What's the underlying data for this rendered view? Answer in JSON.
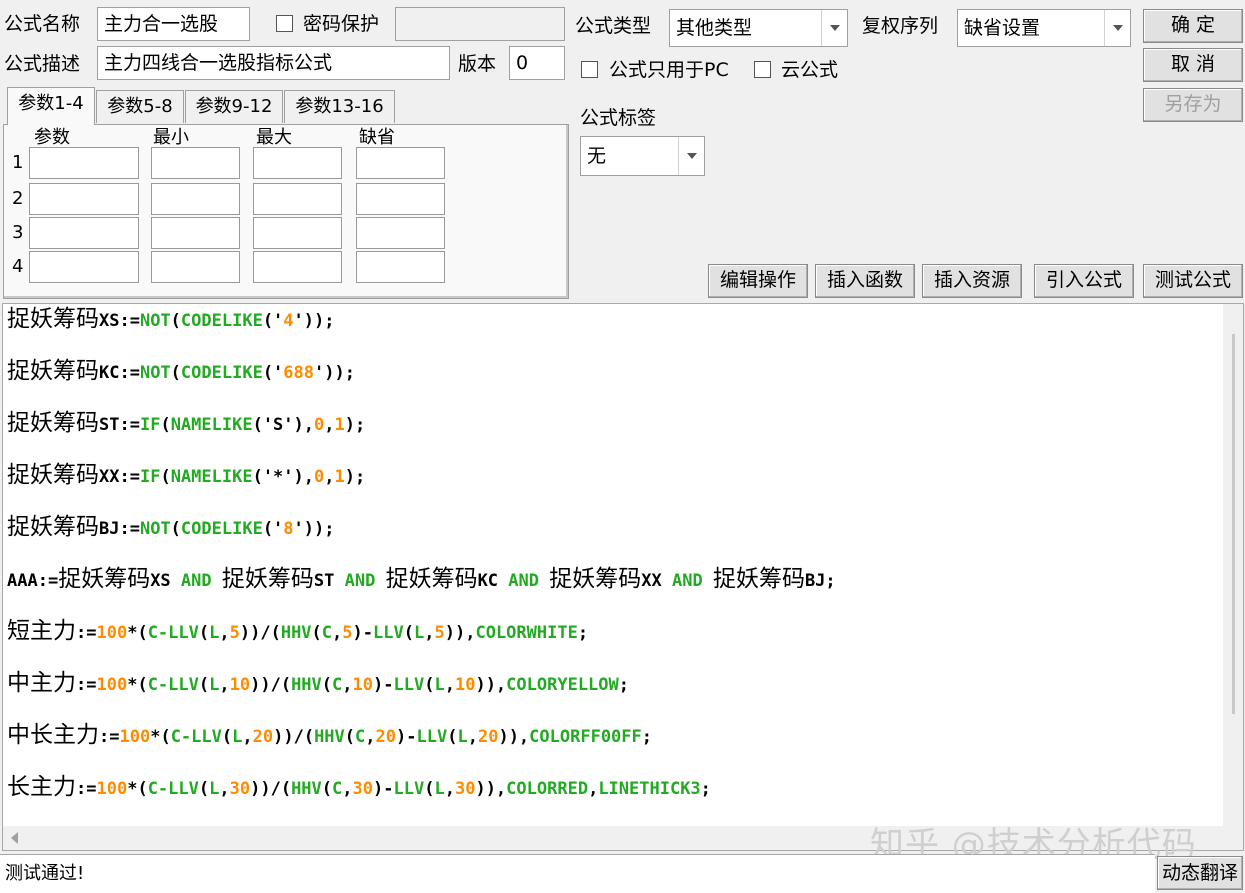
{
  "formula": {
    "name_label": "公式名称",
    "name_value": "主力合一选股",
    "password_label": "密码保护",
    "desc_label": "公式描述",
    "desc_value": "主力四线合一选股指标公式",
    "version_label": "版本",
    "version_value": "0",
    "type_label": "公式类型",
    "type_value": "其他类型",
    "copyright_label": "复权序列",
    "copyright_value": "缺省设置",
    "pc_only_label": "公式只用于PC",
    "cloud_label": "云公式",
    "tag_label": "公式标签",
    "tag_value": "无"
  },
  "buttons": {
    "ok": "确 定",
    "cancel": "取 消",
    "save_as": "另存为",
    "edit_ops": "编辑操作",
    "insert_func": "插入函数",
    "insert_res": "插入资源",
    "import_formula": "引入公式",
    "test_formula": "测试公式",
    "dynamic_translate": "动态翻译"
  },
  "tabs": [
    "参数1-4",
    "参数5-8",
    "参数9-12",
    "参数13-16"
  ],
  "param_headers": [
    "参数",
    "最小",
    "最大",
    "缺省"
  ],
  "param_rows": [
    "1",
    "2",
    "3",
    "4"
  ],
  "code_lines": [
    [
      {
        "t": "捉妖筹码",
        "c": "cn"
      },
      {
        "t": "XS:=",
        "c": "d"
      },
      {
        "t": "NOT",
        "c": "k"
      },
      {
        "t": "(",
        "c": "d"
      },
      {
        "t": "CODELIKE",
        "c": "k"
      },
      {
        "t": "('",
        "c": "d"
      },
      {
        "t": "4",
        "c": "n"
      },
      {
        "t": "'));",
        "c": "d"
      }
    ],
    [
      {
        "t": "捉妖筹码",
        "c": "cn"
      },
      {
        "t": "KC:=",
        "c": "d"
      },
      {
        "t": "NOT",
        "c": "k"
      },
      {
        "t": "(",
        "c": "d"
      },
      {
        "t": "CODELIKE",
        "c": "k"
      },
      {
        "t": "('",
        "c": "d"
      },
      {
        "t": "688",
        "c": "n"
      },
      {
        "t": "'));",
        "c": "d"
      }
    ],
    [
      {
        "t": "捉妖筹码",
        "c": "cn"
      },
      {
        "t": "ST:=",
        "c": "d"
      },
      {
        "t": "IF",
        "c": "k"
      },
      {
        "t": "(",
        "c": "d"
      },
      {
        "t": "NAMELIKE",
        "c": "k"
      },
      {
        "t": "('S'),",
        "c": "d"
      },
      {
        "t": "0",
        "c": "n"
      },
      {
        "t": ",",
        "c": "d"
      },
      {
        "t": "1",
        "c": "n"
      },
      {
        "t": ");",
        "c": "d"
      }
    ],
    [
      {
        "t": "捉妖筹码",
        "c": "cn"
      },
      {
        "t": "XX:=",
        "c": "d"
      },
      {
        "t": "IF",
        "c": "k"
      },
      {
        "t": "(",
        "c": "d"
      },
      {
        "t": "NAMELIKE",
        "c": "k"
      },
      {
        "t": "('*'),",
        "c": "d"
      },
      {
        "t": "0",
        "c": "n"
      },
      {
        "t": ",",
        "c": "d"
      },
      {
        "t": "1",
        "c": "n"
      },
      {
        "t": ");",
        "c": "d"
      }
    ],
    [
      {
        "t": "捉妖筹码",
        "c": "cn"
      },
      {
        "t": "BJ:=",
        "c": "d"
      },
      {
        "t": "NOT",
        "c": "k"
      },
      {
        "t": "(",
        "c": "d"
      },
      {
        "t": "CODELIKE",
        "c": "k"
      },
      {
        "t": "('",
        "c": "d"
      },
      {
        "t": "8",
        "c": "n"
      },
      {
        "t": "'));",
        "c": "d"
      }
    ],
    [
      {
        "t": "AAA:=",
        "c": "d"
      },
      {
        "t": "捉妖筹码",
        "c": "cn"
      },
      {
        "t": "XS ",
        "c": "d"
      },
      {
        "t": "AND",
        "c": "k"
      },
      {
        "t": " ",
        "c": "d"
      },
      {
        "t": "捉妖筹码",
        "c": "cn"
      },
      {
        "t": "ST ",
        "c": "d"
      },
      {
        "t": "AND",
        "c": "k"
      },
      {
        "t": " ",
        "c": "d"
      },
      {
        "t": "捉妖筹码",
        "c": "cn"
      },
      {
        "t": "KC ",
        "c": "d"
      },
      {
        "t": "AND",
        "c": "k"
      },
      {
        "t": " ",
        "c": "d"
      },
      {
        "t": "捉妖筹码",
        "c": "cn"
      },
      {
        "t": "XX ",
        "c": "d"
      },
      {
        "t": "AND",
        "c": "k"
      },
      {
        "t": " ",
        "c": "d"
      },
      {
        "t": "捉妖筹码",
        "c": "cn"
      },
      {
        "t": "BJ;",
        "c": "d"
      }
    ],
    [
      {
        "t": "短主力",
        "c": "cn"
      },
      {
        "t": ":=",
        "c": "d"
      },
      {
        "t": "100",
        "c": "n"
      },
      {
        "t": "*(",
        "c": "d"
      },
      {
        "t": "C-LLV",
        "c": "k"
      },
      {
        "t": "(",
        "c": "d"
      },
      {
        "t": "L",
        "c": "k"
      },
      {
        "t": ",",
        "c": "d"
      },
      {
        "t": "5",
        "c": "n"
      },
      {
        "t": "))/(",
        "c": "d"
      },
      {
        "t": "HHV",
        "c": "k"
      },
      {
        "t": "(",
        "c": "d"
      },
      {
        "t": "C",
        "c": "k"
      },
      {
        "t": ",",
        "c": "d"
      },
      {
        "t": "5",
        "c": "n"
      },
      {
        "t": ")-",
        "c": "d"
      },
      {
        "t": "LLV",
        "c": "k"
      },
      {
        "t": "(",
        "c": "d"
      },
      {
        "t": "L",
        "c": "k"
      },
      {
        "t": ",",
        "c": "d"
      },
      {
        "t": "5",
        "c": "n"
      },
      {
        "t": ")),",
        "c": "d"
      },
      {
        "t": "COLORWHITE",
        "c": "k"
      },
      {
        "t": ";",
        "c": "d"
      }
    ],
    [
      {
        "t": "中主力",
        "c": "cn"
      },
      {
        "t": ":=",
        "c": "d"
      },
      {
        "t": "100",
        "c": "n"
      },
      {
        "t": "*(",
        "c": "d"
      },
      {
        "t": "C-LLV",
        "c": "k"
      },
      {
        "t": "(",
        "c": "d"
      },
      {
        "t": "L",
        "c": "k"
      },
      {
        "t": ",",
        "c": "d"
      },
      {
        "t": "10",
        "c": "n"
      },
      {
        "t": "))/(",
        "c": "d"
      },
      {
        "t": "HHV",
        "c": "k"
      },
      {
        "t": "(",
        "c": "d"
      },
      {
        "t": "C",
        "c": "k"
      },
      {
        "t": ",",
        "c": "d"
      },
      {
        "t": "10",
        "c": "n"
      },
      {
        "t": ")-",
        "c": "d"
      },
      {
        "t": "LLV",
        "c": "k"
      },
      {
        "t": "(",
        "c": "d"
      },
      {
        "t": "L",
        "c": "k"
      },
      {
        "t": ",",
        "c": "d"
      },
      {
        "t": "10",
        "c": "n"
      },
      {
        "t": ")),",
        "c": "d"
      },
      {
        "t": "COLORYELLOW",
        "c": "k"
      },
      {
        "t": ";",
        "c": "d"
      }
    ],
    [
      {
        "t": "中长主力",
        "c": "cn"
      },
      {
        "t": ":=",
        "c": "d"
      },
      {
        "t": "100",
        "c": "n"
      },
      {
        "t": "*(",
        "c": "d"
      },
      {
        "t": "C-LLV",
        "c": "k"
      },
      {
        "t": "(",
        "c": "d"
      },
      {
        "t": "L",
        "c": "k"
      },
      {
        "t": ",",
        "c": "d"
      },
      {
        "t": "20",
        "c": "n"
      },
      {
        "t": "))/(",
        "c": "d"
      },
      {
        "t": "HHV",
        "c": "k"
      },
      {
        "t": "(",
        "c": "d"
      },
      {
        "t": "C",
        "c": "k"
      },
      {
        "t": ",",
        "c": "d"
      },
      {
        "t": "20",
        "c": "n"
      },
      {
        "t": ")-",
        "c": "d"
      },
      {
        "t": "LLV",
        "c": "k"
      },
      {
        "t": "(",
        "c": "d"
      },
      {
        "t": "L",
        "c": "k"
      },
      {
        "t": ",",
        "c": "d"
      },
      {
        "t": "20",
        "c": "n"
      },
      {
        "t": ")),",
        "c": "d"
      },
      {
        "t": "COLORFF00FF",
        "c": "k"
      },
      {
        "t": ";",
        "c": "d"
      }
    ],
    [
      {
        "t": "长主力",
        "c": "cn"
      },
      {
        "t": ":=",
        "c": "d"
      },
      {
        "t": "100",
        "c": "n"
      },
      {
        "t": "*(",
        "c": "d"
      },
      {
        "t": "C-LLV",
        "c": "k"
      },
      {
        "t": "(",
        "c": "d"
      },
      {
        "t": "L",
        "c": "k"
      },
      {
        "t": ",",
        "c": "d"
      },
      {
        "t": "30",
        "c": "n"
      },
      {
        "t": "))/(",
        "c": "d"
      },
      {
        "t": "HHV",
        "c": "k"
      },
      {
        "t": "(",
        "c": "d"
      },
      {
        "t": "C",
        "c": "k"
      },
      {
        "t": ",",
        "c": "d"
      },
      {
        "t": "30",
        "c": "n"
      },
      {
        "t": ")-",
        "c": "d"
      },
      {
        "t": "LLV",
        "c": "k"
      },
      {
        "t": "(",
        "c": "d"
      },
      {
        "t": "L",
        "c": "k"
      },
      {
        "t": ",",
        "c": "d"
      },
      {
        "t": "30",
        "c": "n"
      },
      {
        "t": ")),",
        "c": "d"
      },
      {
        "t": "COLORRED",
        "c": "k"
      },
      {
        "t": ",",
        "c": "d"
      },
      {
        "t": "LINETHICK3",
        "c": "k"
      },
      {
        "t": ";",
        "c": "d"
      }
    ]
  ],
  "status_text": "测试通过!",
  "watermark": "知乎 @技术分析代码",
  "colors": {
    "keyword": "#22aa22",
    "number": "#ff8c00",
    "text": "#000000"
  },
  "icons": {
    "combo": "chevron-down-icon",
    "scroll_left": "arrow-left-icon"
  }
}
